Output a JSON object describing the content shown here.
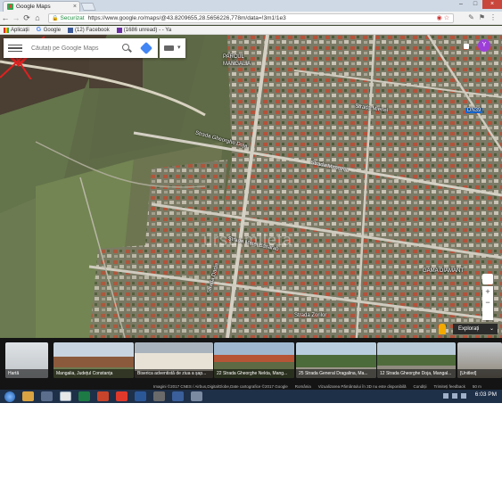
{
  "browser": {
    "tab_title": "Google Maps",
    "tab_close": "×",
    "window_controls": [
      "–",
      "□",
      "×"
    ],
    "secure_label": "Securizat",
    "url": "https://www.google.ro/maps/@43.8209655,28.5656226,778m/data=!3m1!1e3",
    "bookmarks": [
      "Aplicații",
      "Google",
      "(12) Facebook",
      "(1686 unread) - - Ya"
    ]
  },
  "maps": {
    "search_placeholder": "Căutați pe Google Maps",
    "avatar_letter": "Y",
    "labels": {
      "park": "PARCUL",
      "town": "MANGALIA",
      "street1": "Strada Gheorghe Doja",
      "street2": "Strada Mimozei",
      "street3": "Strada Mierlei",
      "street4": "Strada Matei Basarab",
      "street5": "Strada Dacia",
      "street6": "Strada Zorilor",
      "road": "DN39",
      "store": "GAMA DIAMANT"
    },
    "watermark": "ursu-mileta",
    "explore_label": "Explorați",
    "zoom_in": "+",
    "zoom_out": "−"
  },
  "photos": [
    {
      "caption": "Hartă"
    },
    {
      "caption": "Mangalia, Județul Constanța"
    },
    {
      "caption": "Biserica adventistă de ziua a șap..."
    },
    {
      "caption": "22 Strada Gheorghe Nekta, Mang..."
    },
    {
      "caption": "25 Strada General Dragalina, Ma..."
    },
    {
      "caption": "12 Strada Gheorghe Doja, Mangal..."
    },
    {
      "caption": "[Unitled]"
    }
  ],
  "status": {
    "imagery": "Imagini ©2017 CNES / Airbus,DigitalGlobe,Date cartografice ©2017 Google",
    "country": "România",
    "earth": "Vizualizarea Pământului în 3D nu este disponibilă",
    "terms": "Condiții",
    "feedback": "Trimiteți feedback",
    "scale": "50 m"
  },
  "taskbar": {
    "time": "6:03 PM"
  },
  "colors": {
    "marker": "#e02020",
    "avatar": "#9c3fd8",
    "secure": "#1e8e3e"
  }
}
